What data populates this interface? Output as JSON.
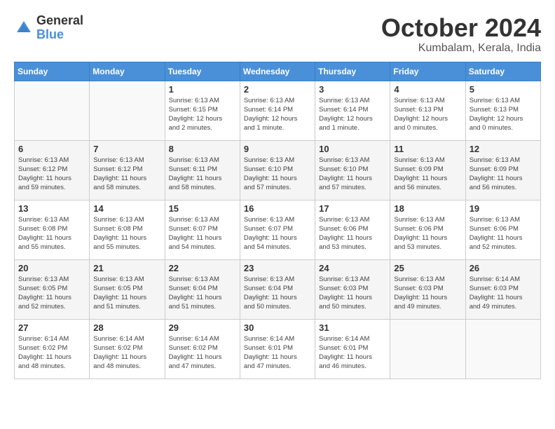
{
  "logo": {
    "general": "General",
    "blue": "Blue"
  },
  "title": "October 2024",
  "subtitle": "Kumbalam, Kerala, India",
  "weekdays": [
    "Sunday",
    "Monday",
    "Tuesday",
    "Wednesday",
    "Thursday",
    "Friday",
    "Saturday"
  ],
  "weeks": [
    [
      {
        "day": "",
        "info": ""
      },
      {
        "day": "",
        "info": ""
      },
      {
        "day": "1",
        "info": "Sunrise: 6:13 AM\nSunset: 6:15 PM\nDaylight: 12 hours\nand 2 minutes."
      },
      {
        "day": "2",
        "info": "Sunrise: 6:13 AM\nSunset: 6:14 PM\nDaylight: 12 hours\nand 1 minute."
      },
      {
        "day": "3",
        "info": "Sunrise: 6:13 AM\nSunset: 6:14 PM\nDaylight: 12 hours\nand 1 minute."
      },
      {
        "day": "4",
        "info": "Sunrise: 6:13 AM\nSunset: 6:13 PM\nDaylight: 12 hours\nand 0 minutes."
      },
      {
        "day": "5",
        "info": "Sunrise: 6:13 AM\nSunset: 6:13 PM\nDaylight: 12 hours\nand 0 minutes."
      }
    ],
    [
      {
        "day": "6",
        "info": "Sunrise: 6:13 AM\nSunset: 6:12 PM\nDaylight: 11 hours\nand 59 minutes."
      },
      {
        "day": "7",
        "info": "Sunrise: 6:13 AM\nSunset: 6:12 PM\nDaylight: 11 hours\nand 58 minutes."
      },
      {
        "day": "8",
        "info": "Sunrise: 6:13 AM\nSunset: 6:11 PM\nDaylight: 11 hours\nand 58 minutes."
      },
      {
        "day": "9",
        "info": "Sunrise: 6:13 AM\nSunset: 6:10 PM\nDaylight: 11 hours\nand 57 minutes."
      },
      {
        "day": "10",
        "info": "Sunrise: 6:13 AM\nSunset: 6:10 PM\nDaylight: 11 hours\nand 57 minutes."
      },
      {
        "day": "11",
        "info": "Sunrise: 6:13 AM\nSunset: 6:09 PM\nDaylight: 11 hours\nand 56 minutes."
      },
      {
        "day": "12",
        "info": "Sunrise: 6:13 AM\nSunset: 6:09 PM\nDaylight: 11 hours\nand 56 minutes."
      }
    ],
    [
      {
        "day": "13",
        "info": "Sunrise: 6:13 AM\nSunset: 6:08 PM\nDaylight: 11 hours\nand 55 minutes."
      },
      {
        "day": "14",
        "info": "Sunrise: 6:13 AM\nSunset: 6:08 PM\nDaylight: 11 hours\nand 55 minutes."
      },
      {
        "day": "15",
        "info": "Sunrise: 6:13 AM\nSunset: 6:07 PM\nDaylight: 11 hours\nand 54 minutes."
      },
      {
        "day": "16",
        "info": "Sunrise: 6:13 AM\nSunset: 6:07 PM\nDaylight: 11 hours\nand 54 minutes."
      },
      {
        "day": "17",
        "info": "Sunrise: 6:13 AM\nSunset: 6:06 PM\nDaylight: 11 hours\nand 53 minutes."
      },
      {
        "day": "18",
        "info": "Sunrise: 6:13 AM\nSunset: 6:06 PM\nDaylight: 11 hours\nand 53 minutes."
      },
      {
        "day": "19",
        "info": "Sunrise: 6:13 AM\nSunset: 6:06 PM\nDaylight: 11 hours\nand 52 minutes."
      }
    ],
    [
      {
        "day": "20",
        "info": "Sunrise: 6:13 AM\nSunset: 6:05 PM\nDaylight: 11 hours\nand 52 minutes."
      },
      {
        "day": "21",
        "info": "Sunrise: 6:13 AM\nSunset: 6:05 PM\nDaylight: 11 hours\nand 51 minutes."
      },
      {
        "day": "22",
        "info": "Sunrise: 6:13 AM\nSunset: 6:04 PM\nDaylight: 11 hours\nand 51 minutes."
      },
      {
        "day": "23",
        "info": "Sunrise: 6:13 AM\nSunset: 6:04 PM\nDaylight: 11 hours\nand 50 minutes."
      },
      {
        "day": "24",
        "info": "Sunrise: 6:13 AM\nSunset: 6:03 PM\nDaylight: 11 hours\nand 50 minutes."
      },
      {
        "day": "25",
        "info": "Sunrise: 6:13 AM\nSunset: 6:03 PM\nDaylight: 11 hours\nand 49 minutes."
      },
      {
        "day": "26",
        "info": "Sunrise: 6:14 AM\nSunset: 6:03 PM\nDaylight: 11 hours\nand 49 minutes."
      }
    ],
    [
      {
        "day": "27",
        "info": "Sunrise: 6:14 AM\nSunset: 6:02 PM\nDaylight: 11 hours\nand 48 minutes."
      },
      {
        "day": "28",
        "info": "Sunrise: 6:14 AM\nSunset: 6:02 PM\nDaylight: 11 hours\nand 48 minutes."
      },
      {
        "day": "29",
        "info": "Sunrise: 6:14 AM\nSunset: 6:02 PM\nDaylight: 11 hours\nand 47 minutes."
      },
      {
        "day": "30",
        "info": "Sunrise: 6:14 AM\nSunset: 6:01 PM\nDaylight: 11 hours\nand 47 minutes."
      },
      {
        "day": "31",
        "info": "Sunrise: 6:14 AM\nSunset: 6:01 PM\nDaylight: 11 hours\nand 46 minutes."
      },
      {
        "day": "",
        "info": ""
      },
      {
        "day": "",
        "info": ""
      }
    ]
  ]
}
